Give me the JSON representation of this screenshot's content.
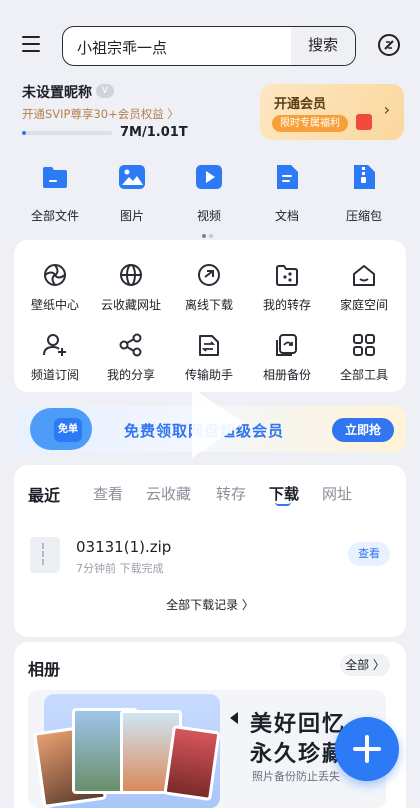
{
  "header": {
    "search_placeholder": "小祖宗乖一点",
    "search_button": "搜索"
  },
  "account": {
    "nickname": "未设置昵称",
    "vip_badge": "V",
    "vip_promo": "开通SVIP尊享30+会员权益 〉",
    "storage": "7M/1.01T",
    "storage_used_fraction": 0.04
  },
  "member_card": {
    "title": "开通会员",
    "subtitle": "限时专属福利",
    "arrow": "›"
  },
  "categories": [
    {
      "label": "全部文件",
      "icon": "folder-icon"
    },
    {
      "label": "图片",
      "icon": "image-icon"
    },
    {
      "label": "视频",
      "icon": "video-icon"
    },
    {
      "label": "文档",
      "icon": "document-icon"
    },
    {
      "label": "压缩包",
      "icon": "zip-icon"
    }
  ],
  "tools": [
    {
      "label": "壁纸中心",
      "icon": "wallpaper-icon"
    },
    {
      "label": "云收藏网址",
      "icon": "globe-icon"
    },
    {
      "label": "离线下载",
      "icon": "offline-download-icon"
    },
    {
      "label": "我的转存",
      "icon": "transfer-folder-icon"
    },
    {
      "label": "家庭空间",
      "icon": "home-icon"
    },
    {
      "label": "频道订阅",
      "icon": "subscribe-icon"
    },
    {
      "label": "我的分享",
      "icon": "share-icon"
    },
    {
      "label": "传输助手",
      "icon": "transfer-assistant-icon"
    },
    {
      "label": "相册备份",
      "icon": "album-backup-icon"
    },
    {
      "label": "全部工具",
      "icon": "grid-icon"
    }
  ],
  "banner": {
    "badge": "免单",
    "text": "免费领取网盘超级会员",
    "button": "立即抢"
  },
  "recent": {
    "tabs": [
      "最近",
      "查看",
      "云收藏",
      "转存",
      "下载",
      "网址"
    ],
    "active_tab": "下载",
    "file_name": "03131(1).zip",
    "file_meta": "7分钟前 下载完成",
    "view_button": "查看",
    "all_records": "全部下载记录 〉"
  },
  "album": {
    "title": "相册",
    "all_button": "全部 〉",
    "slogan_line1": "美好回忆",
    "slogan_line2": "永久珍藏",
    "slogan_sub": "照片备份防止丢失"
  },
  "colors": {
    "accent": "#2d7af6",
    "vip_gold": "#b6804a",
    "background": "#eef0f5"
  }
}
